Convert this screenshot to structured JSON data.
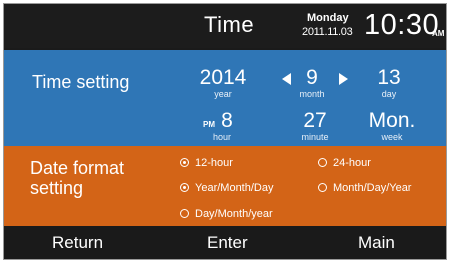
{
  "header": {
    "title": "Time",
    "day_of_week": "Monday",
    "date": "2011.11.03",
    "time": "10:30",
    "ampm": "AM"
  },
  "time_setting": {
    "label": "Time setting",
    "year": {
      "value": "2014",
      "unit": "year"
    },
    "month": {
      "value": "9",
      "unit": "month"
    },
    "day": {
      "value": "13",
      "unit": "day"
    },
    "hour": {
      "value": "8",
      "unit": "hour",
      "period": "PM"
    },
    "minute": {
      "value": "27",
      "unit": "minute"
    },
    "week": {
      "value": "Mon.",
      "unit": "week"
    }
  },
  "date_format": {
    "label_line1": "Date format",
    "label_line2": "setting",
    "options": [
      {
        "label": "12-hour",
        "selected": true
      },
      {
        "label": "24-hour",
        "selected": false
      },
      {
        "label": "Year/Month/Day",
        "selected": true
      },
      {
        "label": "Month/Day/Year",
        "selected": false
      },
      {
        "label": "Day/Month/year",
        "selected": false
      }
    ]
  },
  "footer": {
    "return_label": "Return",
    "enter_label": "Enter",
    "main_label": "Main"
  },
  "colors": {
    "header_bg": "#1c1c1c",
    "time_panel_bg": "#2f76b6",
    "date_panel_bg": "#d36417",
    "footer_bg": "#1a1a1a",
    "text": "#ffffff"
  }
}
